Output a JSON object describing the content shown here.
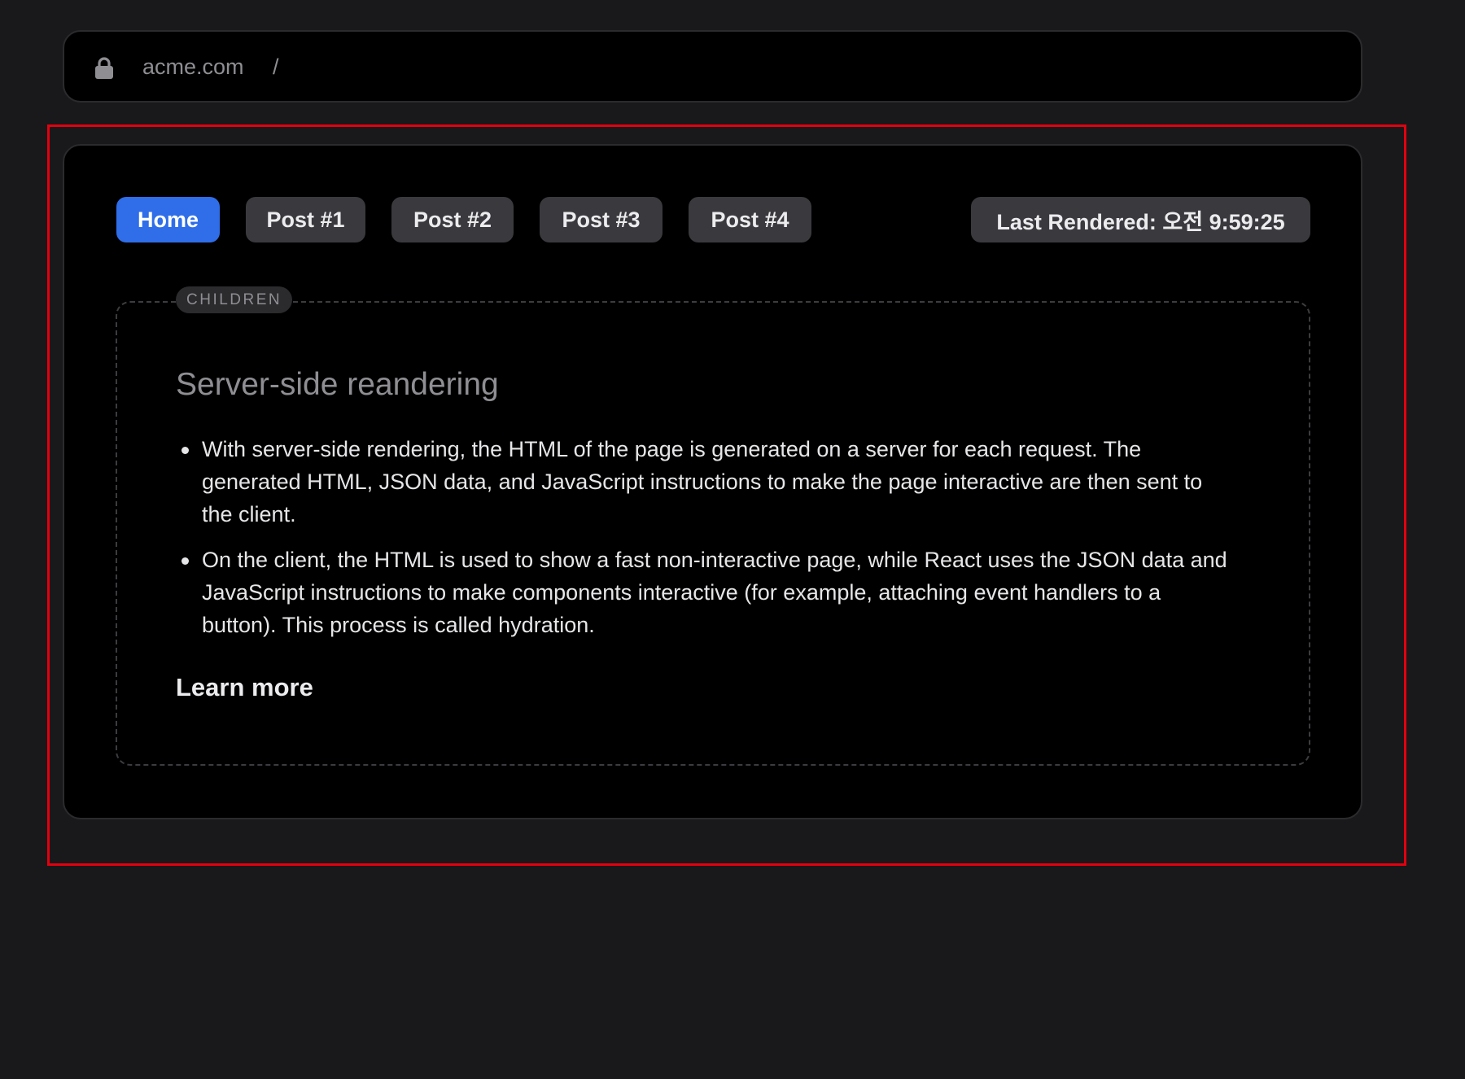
{
  "address_bar": {
    "domain": "acme.com",
    "path_separator": "/",
    "lock_icon": "lock-icon"
  },
  "nav": {
    "items": [
      {
        "label": "Home",
        "active": true
      },
      {
        "label": "Post #1",
        "active": false
      },
      {
        "label": "Post #2",
        "active": false
      },
      {
        "label": "Post #3",
        "active": false
      },
      {
        "label": "Post #4",
        "active": false
      }
    ],
    "last_rendered": "Last Rendered: 오전 9:59:25"
  },
  "children": {
    "tag": "CHILDREN",
    "heading": "Server-side reandering",
    "bullets": [
      "With server-side rendering, the HTML of the page is generated on a server for each request. The generated HTML, JSON data, and JavaScript instructions to make the page interactive are then sent to the client.",
      "On the client, the HTML is used to show a fast non-interactive page, while React uses the JSON data and JavaScript instructions to make components interactive (for example, attaching event handlers to a button). This process is called hydration."
    ],
    "link_label": "Learn more"
  },
  "colors": {
    "page_background": "#19191b",
    "card_background": "#000000",
    "active_accent": "#2f6ee8",
    "button_background": "#3a3a3e",
    "highlight_frame": "#e3000f"
  }
}
